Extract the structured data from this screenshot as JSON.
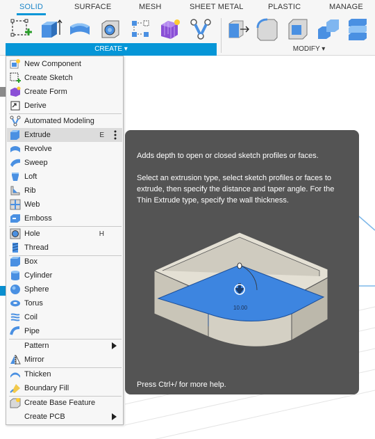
{
  "tabs": [
    "SOLID",
    "SURFACE",
    "MESH",
    "SHEET METAL",
    "PLASTIC",
    "MANAGE"
  ],
  "toolbar": {
    "create_label": "CREATE ▾",
    "modify_label": "MODIFY ▾",
    "create_tools": [
      "new-sketch",
      "extrude",
      "revolve",
      "hole",
      "pattern",
      "create-form",
      "automated-modeling"
    ],
    "modify_tools": [
      "press-pull",
      "fillet",
      "shell",
      "combine",
      "align"
    ]
  },
  "menu": {
    "items": [
      {
        "label": "New Component",
        "icon": "new-component-icon"
      },
      {
        "label": "Create Sketch",
        "icon": "create-sketch-icon"
      },
      {
        "label": "Create Form",
        "icon": "create-form-icon"
      },
      {
        "label": "Derive",
        "icon": "derive-icon"
      },
      {
        "label": "Automated Modeling",
        "icon": "automated-modeling-icon"
      },
      {
        "label": "Extrude",
        "icon": "extrude-icon",
        "shortcut": "E",
        "highlighted": true
      },
      {
        "label": "Revolve",
        "icon": "revolve-icon"
      },
      {
        "label": "Sweep",
        "icon": "sweep-icon"
      },
      {
        "label": "Loft",
        "icon": "loft-icon"
      },
      {
        "label": "Rib",
        "icon": "rib-icon"
      },
      {
        "label": "Web",
        "icon": "web-icon"
      },
      {
        "label": "Emboss",
        "icon": "emboss-icon"
      },
      {
        "label": "Hole",
        "icon": "hole-icon",
        "shortcut": "H"
      },
      {
        "label": "Thread",
        "icon": "thread-icon"
      },
      {
        "label": "Box",
        "icon": "box-icon"
      },
      {
        "label": "Cylinder",
        "icon": "cylinder-icon"
      },
      {
        "label": "Sphere",
        "icon": "sphere-icon"
      },
      {
        "label": "Torus",
        "icon": "torus-icon"
      },
      {
        "label": "Coil",
        "icon": "coil-icon"
      },
      {
        "label": "Pipe",
        "icon": "pipe-icon"
      },
      {
        "label": "Pattern",
        "icon": "",
        "submenu": true
      },
      {
        "label": "Mirror",
        "icon": "mirror-icon"
      },
      {
        "label": "Thicken",
        "icon": "thicken-icon"
      },
      {
        "label": "Boundary Fill",
        "icon": "boundary-fill-icon"
      },
      {
        "label": "Create Base Feature",
        "icon": "create-base-feature-icon"
      },
      {
        "label": "Create PCB",
        "icon": "",
        "submenu": true
      }
    ]
  },
  "tooltip": {
    "line1": "Adds depth to open or closed sketch profiles or faces.",
    "line2": "Select an extrusion type, select sketch profiles or faces to extrude, then specify the distance and taper angle. For the Thin Extrude type, specify the wall thickness.",
    "help": "Press Ctrl+/ for more help.",
    "dimension": "10.00"
  },
  "colors": {
    "accent": "#0696d7",
    "tooltip_bg": "#545454",
    "menu_bg": "#f7f7f7",
    "highlight": "#dcdcdc",
    "solid_blue": "#3d85e0"
  }
}
